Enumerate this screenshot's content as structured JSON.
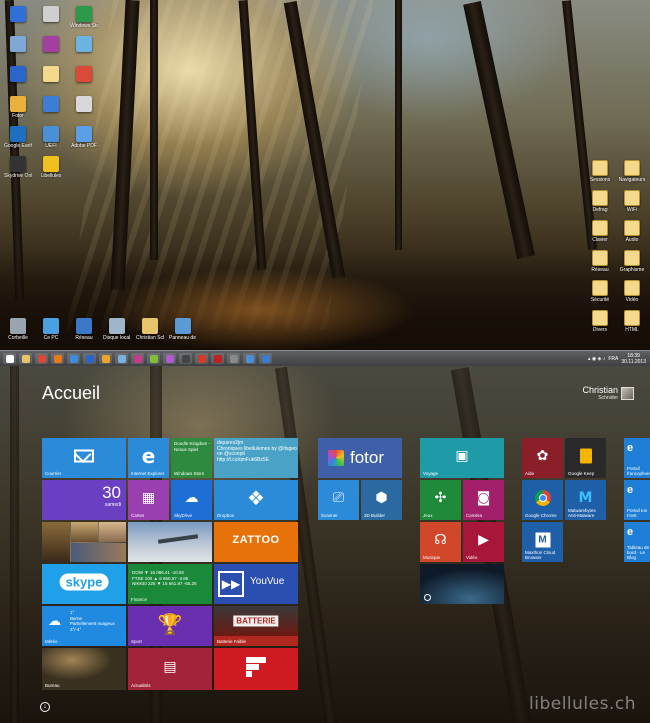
{
  "desktop": {
    "left_icons": [
      {
        "label": "",
        "color": "#2f6fd6"
      },
      {
        "label": "",
        "color": "#cfcfcf"
      },
      {
        "label": "Windows Store",
        "color": "#2c9a4a"
      },
      {
        "label": "",
        "color": "#7fa8d6"
      },
      {
        "label": "",
        "color": "#a33fa0"
      },
      {
        "label": "",
        "color": "#6bb3e0"
      },
      {
        "label": "",
        "color": "#2a66c9"
      },
      {
        "label": "",
        "color": "#f3d98c"
      },
      {
        "label": "",
        "color": "#d94a3a"
      },
      {
        "label": "Fotor",
        "color": "#e8b23a"
      },
      {
        "label": "",
        "color": "#3c7dd6"
      },
      {
        "label": "",
        "color": "#d8d8d8"
      },
      {
        "label": "Google Earth",
        "color": "#1f6fc0"
      },
      {
        "label": "UEFI",
        "color": "#4a90d9"
      },
      {
        "label": "Adobe PDF",
        "color": "#5aa0e8"
      },
      {
        "label": "Skydrive Online",
        "color": "#333333"
      },
      {
        "label": "Libellules",
        "color": "#f0c020"
      }
    ],
    "bottom_icons": [
      {
        "label": "Corbeille",
        "color": "#9aa4ae"
      },
      {
        "label": "Ce PC",
        "color": "#4aa0e0"
      },
      {
        "label": "Réseau",
        "color": "#3b78c8"
      },
      {
        "label": "Disque local (C)",
        "color": "#9fb6c8"
      },
      {
        "label": "Christian Schnider",
        "color": "#e8c46a"
      },
      {
        "label": "Panneau de configuration",
        "color": "#5a9ad6"
      }
    ],
    "right_icons": [
      {
        "label": "Sessions",
        "color": "#f3d98c"
      },
      {
        "label": "Navigateurs",
        "color": "#f3d98c"
      },
      {
        "label": "Defrag",
        "color": "#f3d98c"
      },
      {
        "label": "WiFi",
        "color": "#f3d98c"
      },
      {
        "label": "Clavier",
        "color": "#f3d98c"
      },
      {
        "label": "Audio",
        "color": "#f3d98c"
      },
      {
        "label": "Réseau",
        "color": "#f3d98c"
      },
      {
        "label": "Graphisme",
        "color": "#f3d98c"
      },
      {
        "label": "Sécurité",
        "color": "#f3d98c"
      },
      {
        "label": "Vidéo",
        "color": "#f3d98c"
      },
      {
        "label": "Divers",
        "color": "#f3d98c"
      },
      {
        "label": "HTML",
        "color": "#f3d98c"
      }
    ]
  },
  "taskbar": {
    "apps": [
      {
        "name": "start-button-icon",
        "color": "#ffffff"
      },
      {
        "name": "explorer-icon",
        "color": "#e9c46a"
      },
      {
        "name": "chrome-icon",
        "color": "#d94a3a"
      },
      {
        "name": "firefox-icon",
        "color": "#e87a1a"
      },
      {
        "name": "ie-icon",
        "color": "#3c8ce0"
      },
      {
        "name": "outlook-icon",
        "color": "#2a66c9"
      },
      {
        "name": "media-icon",
        "color": "#f3a32c"
      },
      {
        "name": "settings-icon",
        "color": "#7ab0e0"
      },
      {
        "name": "photos-icon",
        "color": "#c73b8a"
      },
      {
        "name": "paint-icon",
        "color": "#7fc03a"
      },
      {
        "name": "notes-icon",
        "color": "#b05ad0"
      },
      {
        "name": "terminal-icon",
        "color": "#444444"
      },
      {
        "name": "ccleaner-icon",
        "color": "#d33a2a"
      },
      {
        "name": "filezilla-icon",
        "color": "#c02020"
      },
      {
        "name": "calc-icon",
        "color": "#8a8a8a"
      },
      {
        "name": "screen-icon",
        "color": "#4a90d9"
      },
      {
        "name": "help-icon",
        "color": "#3a7cd0"
      }
    ],
    "lang": "FRA",
    "time": "18:39",
    "date": "30.11.2013"
  },
  "start": {
    "title": "Accueil",
    "user_name": "Christian",
    "user_sub": "Schnider",
    "tiles": {
      "mail": {
        "label": "Courrier",
        "color": "#2b8bd9"
      },
      "ie": {
        "label": "Internet Explorer",
        "color": "#2b8bd9"
      },
      "store": {
        "label": "Windows Store",
        "color": "#2e8a3e",
        "text": "Doodle Kingdom - Nexus Spiel"
      },
      "twitter": {
        "label": "",
        "color": "#4aa3c7",
        "text": "depares2jm\nChroniques libellulemes by @Itsgeo on @scoopit http://t.co/qmFuk6Bz5E"
      },
      "fotor": {
        "label": "",
        "color": "#3f5fa8",
        "text": "fotor"
      },
      "voyage": {
        "label": "Voyage",
        "color": "#1f9ba8"
      },
      "aide": {
        "label": "Aide",
        "color": "#8a1f2a"
      },
      "keep": {
        "label": "Google Keep",
        "color": "#2a2a2a"
      },
      "calendar": {
        "label": "samedi",
        "color": "#6a3fc1",
        "day": "30"
      },
      "cartes": {
        "label": "Cartes",
        "color": "#9a3fb0"
      },
      "skydrive": {
        "label": "SkyDrive",
        "color": "#1f6ed6"
      },
      "dropbox": {
        "label": "Dropbox",
        "color": "#2b8bd9"
      },
      "scanner": {
        "label": "Scanner",
        "color": "#2b8bd9"
      },
      "builder": {
        "label": "3D Builder",
        "color": "#2b6aa0"
      },
      "jeux": {
        "label": "Jeux",
        "color": "#1e8a3a"
      },
      "camera": {
        "label": "Caméra",
        "color": "#a21f6a"
      },
      "chrome": {
        "label": "Google Chrome",
        "color": "#1f5fa8"
      },
      "malware": {
        "label": "Malwarebytes Anti-Malware",
        "color": "#1f5fa8"
      },
      "zattoo": {
        "label": "",
        "color": "#e8720a",
        "text": "ZATTOO"
      },
      "musique": {
        "label": "Musique",
        "color": "#d1472a"
      },
      "video": {
        "label": "Vidéo",
        "color": "#a8163a"
      },
      "maxthon": {
        "label": "Maxthon Cloud Browser",
        "color": "#1f5fa8"
      },
      "skype": {
        "label": "",
        "color": "#1fa0e8",
        "text": "skype"
      },
      "finance": {
        "label": "Finance",
        "color": "#1a8a3a",
        "text": "DOW   ▼ 16 086.41 -10.92\nFTSE 100  ▲ 6 650.57 -3.85\nNIKKEI 225  ▼ 15 661.87 -65.25"
      },
      "youvue": {
        "label": "",
        "color": "#2a4fb0",
        "text": "YouVue"
      },
      "meteo": {
        "label": "Météo",
        "color": "#1f8ae0",
        "text": "1°\nBerne\nPartiellement nuageux\n3°/-4°"
      },
      "sport": {
        "label": "Sport",
        "color": "#6a2fb0"
      },
      "batterie": {
        "label": "Batterie Faible",
        "color": "#b0281f",
        "text": "BATTERIE"
      },
      "bureau": {
        "label": "Bureau",
        "color": "#3a3020"
      },
      "actualites": {
        "label": "Actualités",
        "color": "#a3233a"
      },
      "flipboard": {
        "label": "",
        "color": "#d01a22"
      },
      "partial1": {
        "label": "Portail francophone",
        "color": "#1f7fd6"
      },
      "partial2": {
        "label": "Portail ton n'est",
        "color": "#1f7fd6"
      },
      "partial3": {
        "label": "Tableau de bord - Le Blog",
        "color": "#1f7fd6"
      }
    },
    "watermark": "libellules.ch"
  }
}
